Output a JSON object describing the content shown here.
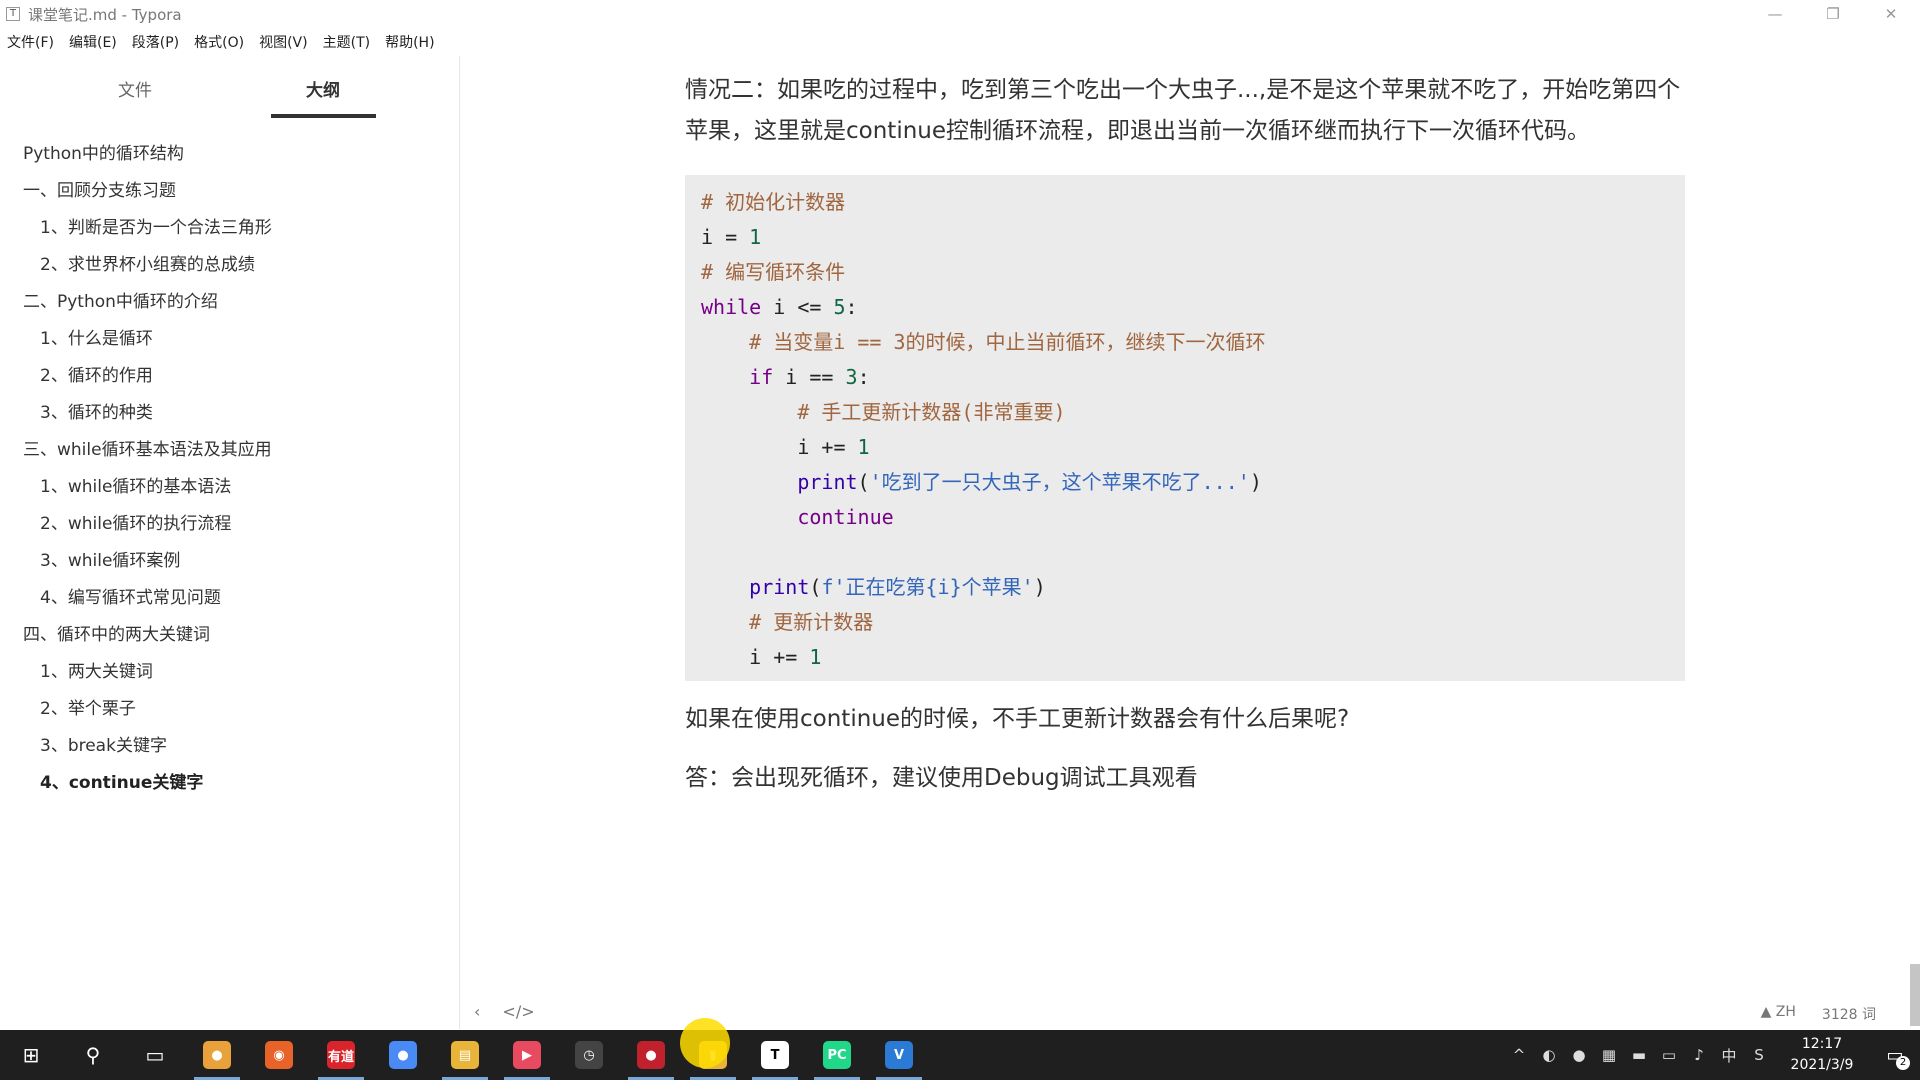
{
  "window": {
    "app_icon_text": "T",
    "title": "课堂笔记.md - Typora",
    "minimize": "—",
    "restore": "❐",
    "close": "✕"
  },
  "menu": [
    "文件(F)",
    "编辑(E)",
    "段落(P)",
    "格式(O)",
    "视图(V)",
    "主题(T)",
    "帮助(H)"
  ],
  "sidebar": {
    "tabs": {
      "files": "文件",
      "outline": "大纲"
    },
    "outline": [
      {
        "label": "Python中的循环结构",
        "level": 1
      },
      {
        "label": "一、回顾分支练习题",
        "level": 1
      },
      {
        "label": "1、判断是否为一个合法三角形",
        "level": 2
      },
      {
        "label": "2、求世界杯小组赛的总成绩",
        "level": 2
      },
      {
        "label": "二、Python中循环的介绍",
        "level": 1
      },
      {
        "label": "1、什么是循环",
        "level": 2
      },
      {
        "label": "2、循环的作用",
        "level": 2
      },
      {
        "label": "3、循环的种类",
        "level": 2
      },
      {
        "label": "三、while循环基本语法及其应用",
        "level": 1
      },
      {
        "label": "1、while循环的基本语法",
        "level": 2
      },
      {
        "label": "2、while循环的执行流程",
        "level": 2
      },
      {
        "label": "3、while循环案例",
        "level": 2
      },
      {
        "label": "4、编写循环式常见问题",
        "level": 2
      },
      {
        "label": "四、循环中的两大关键词",
        "level": 1
      },
      {
        "label": "1、两大关键词",
        "level": 2
      },
      {
        "label": "2、举个栗子",
        "level": 2
      },
      {
        "label": "3、break关键字",
        "level": 2
      },
      {
        "label": "4、continue关键字",
        "level": 2,
        "active": true
      }
    ]
  },
  "main": {
    "intro": "情况二：如果吃的过程中，吃到第三个吃出一个大虫子...,是不是这个苹果就不吃了，开始吃第四个苹果，这里就是continue控制循环流程，即退出当前一次循环继而执行下一次循环代码。",
    "code": [
      [
        {
          "t": "# 初始化计数器",
          "c": "com"
        }
      ],
      [
        {
          "t": "i",
          "c": "var"
        },
        {
          "t": " = ",
          "c": "var"
        },
        {
          "t": "1",
          "c": "num"
        }
      ],
      [
        {
          "t": "# 编写循环条件",
          "c": "com"
        }
      ],
      [
        {
          "t": "while",
          "c": "kw"
        },
        {
          "t": " i <= ",
          "c": "var"
        },
        {
          "t": "5",
          "c": "num"
        },
        {
          "t": ":",
          "c": "var"
        }
      ],
      [
        {
          "t": "    # 当变量i == 3的时候，中止当前循环，继续下一次循环",
          "c": "com"
        }
      ],
      [
        {
          "t": "    ",
          "c": "var"
        },
        {
          "t": "if",
          "c": "kw"
        },
        {
          "t": " i == ",
          "c": "var"
        },
        {
          "t": "3",
          "c": "num"
        },
        {
          "t": ":",
          "c": "var"
        }
      ],
      [
        {
          "t": "        # 手工更新计数器(非常重要)",
          "c": "com"
        }
      ],
      [
        {
          "t": "        i += ",
          "c": "var"
        },
        {
          "t": "1",
          "c": "num"
        }
      ],
      [
        {
          "t": "        ",
          "c": "var"
        },
        {
          "t": "print",
          "c": "fn"
        },
        {
          "t": "(",
          "c": "var"
        },
        {
          "t": "'吃到了一只大虫子，这个苹果不吃了...'",
          "c": "str"
        },
        {
          "t": ")",
          "c": "var"
        }
      ],
      [
        {
          "t": "        ",
          "c": "var"
        },
        {
          "t": "continue",
          "c": "kw"
        }
      ],
      [
        {
          "t": "",
          "c": "var"
        }
      ],
      [
        {
          "t": "    ",
          "c": "var"
        },
        {
          "t": "print",
          "c": "fn"
        },
        {
          "t": "(",
          "c": "var"
        },
        {
          "t": "f'正在吃第{i}个苹果'",
          "c": "str"
        },
        {
          "t": ")",
          "c": "var"
        }
      ],
      [
        {
          "t": "    # 更新计数器",
          "c": "com"
        }
      ],
      [
        {
          "t": "    i += ",
          "c": "var"
        },
        {
          "t": "1",
          "c": "num"
        }
      ]
    ],
    "question": "如果在使用continue的时候，不手工更新计数器会有什么后果呢?",
    "answer": "答：会出现死循环，建议使用Debug调试工具观看"
  },
  "status": {
    "back": "‹",
    "source_toggle": "</>",
    "lang": "▲ ZH",
    "word_count": "3128 词"
  },
  "taskbar": {
    "apps": [
      {
        "name": "start",
        "glyph": "⊞",
        "color": "#1f1f1f"
      },
      {
        "name": "search",
        "glyph": "⚲",
        "color": "#1f1f1f"
      },
      {
        "name": "task-view",
        "glyph": "▭",
        "color": "#1f1f1f"
      },
      {
        "name": "chrome",
        "glyph": "●",
        "color": "#e9a23b"
      },
      {
        "name": "firefox",
        "glyph": "◉",
        "color": "#e8632a"
      },
      {
        "name": "youdao",
        "glyph": "有道",
        "color": "#d8242a"
      },
      {
        "name": "chrome-alt",
        "glyph": "●",
        "color": "#4a8af4"
      },
      {
        "name": "file-explorer",
        "glyph": "▤",
        "color": "#e8b53a"
      },
      {
        "name": "video-app",
        "glyph": "▶",
        "color": "#e84a5f"
      },
      {
        "name": "clock-app",
        "glyph": "◷",
        "color": "#444"
      },
      {
        "name": "recorder",
        "glyph": "●",
        "color": "#c0212c"
      },
      {
        "name": "folder",
        "glyph": "▮",
        "color": "#e8b53a"
      },
      {
        "name": "typora",
        "glyph": "T",
        "color": "#ffffff"
      },
      {
        "name": "pycharm",
        "glyph": "PC",
        "color": "#21d789"
      },
      {
        "name": "vscode",
        "glyph": "V",
        "color": "#2a7ad6"
      }
    ],
    "tray_icons": [
      "^",
      "◐",
      "●",
      "▦",
      "▬",
      "▭",
      "♪",
      "中",
      "S"
    ],
    "time": "12:17",
    "date": "2021/3/9",
    "notification_count": "2"
  }
}
